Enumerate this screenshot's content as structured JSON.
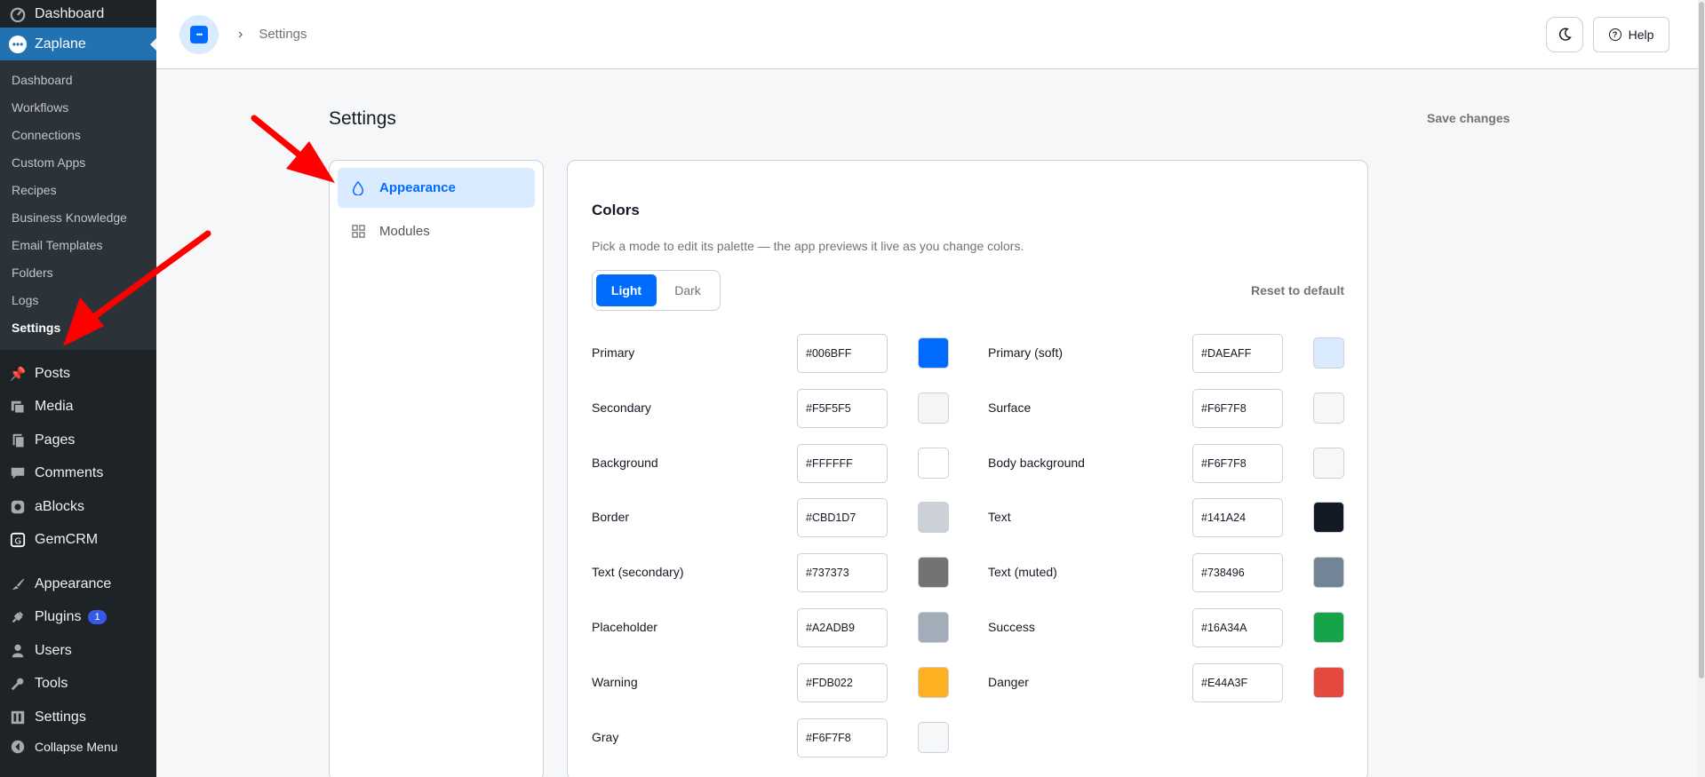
{
  "wp_sidebar": {
    "top_item": "Dashboard",
    "active_plugin": "Zaplane",
    "submenu": [
      "Dashboard",
      "Workflows",
      "Connections",
      "Custom Apps",
      "Recipes",
      "Business Knowledge",
      "Email Templates",
      "Folders",
      "Logs",
      "Settings"
    ],
    "menu": [
      {
        "label": "Posts",
        "icon": "pin-icon"
      },
      {
        "label": "Media",
        "icon": "media-icon"
      },
      {
        "label": "Pages",
        "icon": "pages-icon"
      },
      {
        "label": "Comments",
        "icon": "comment-icon"
      },
      {
        "label": "aBlocks",
        "icon": "ablocks-icon"
      },
      {
        "label": "GemCRM",
        "icon": "gemcrm-icon"
      },
      {
        "label": "Appearance",
        "icon": "brush-icon"
      },
      {
        "label": "Plugins",
        "icon": "plug-icon",
        "badge": "1"
      },
      {
        "label": "Users",
        "icon": "user-icon"
      },
      {
        "label": "Tools",
        "icon": "wrench-icon"
      },
      {
        "label": "Settings",
        "icon": "settings-icon"
      },
      {
        "label": "Collapse Menu",
        "icon": "collapse-icon"
      }
    ]
  },
  "header": {
    "breadcrumb": "Settings",
    "help_label": "Help"
  },
  "page": {
    "title": "Settings",
    "save_label": "Save changes"
  },
  "nav": {
    "items": [
      {
        "label": "Appearance",
        "icon": "droplet-icon",
        "active": true
      },
      {
        "label": "Modules",
        "icon": "grid-icon",
        "active": false
      }
    ]
  },
  "colors": {
    "title": "Colors",
    "description": "Pick a mode to edit its palette — the app previews it live as you change colors.",
    "modes": [
      "Light",
      "Dark"
    ],
    "selected_mode": "Light",
    "reset_label": "Reset to default",
    "left": [
      {
        "label": "Primary",
        "hex": "#006BFF"
      },
      {
        "label": "Secondary",
        "hex": "#F5F5F5"
      },
      {
        "label": "Background",
        "hex": "#FFFFFF"
      },
      {
        "label": "Border",
        "hex": "#CBD1D7"
      },
      {
        "label": "Text (secondary)",
        "hex": "#737373"
      },
      {
        "label": "Placeholder",
        "hex": "#A2ADB9"
      },
      {
        "label": "Warning",
        "hex": "#FDB022"
      },
      {
        "label": "Gray",
        "hex": "#F6F7F8"
      }
    ],
    "right": [
      {
        "label": "Primary (soft)",
        "hex": "#DAEAFF"
      },
      {
        "label": "Surface",
        "hex": "#F6F7F8"
      },
      {
        "label": "Body background",
        "hex": "#F6F7F8"
      },
      {
        "label": "Text",
        "hex": "#141A24"
      },
      {
        "label": "Text (muted)",
        "hex": "#738496"
      },
      {
        "label": "Success",
        "hex": "#16A34A"
      },
      {
        "label": "Danger",
        "hex": "#E44A3F"
      }
    ]
  },
  "theme": {
    "accent": "#006BFF",
    "wp_sidebar_bg": "#1d2327",
    "wp_active": "#2271b1",
    "annotation_arrow": "#FF0000"
  }
}
